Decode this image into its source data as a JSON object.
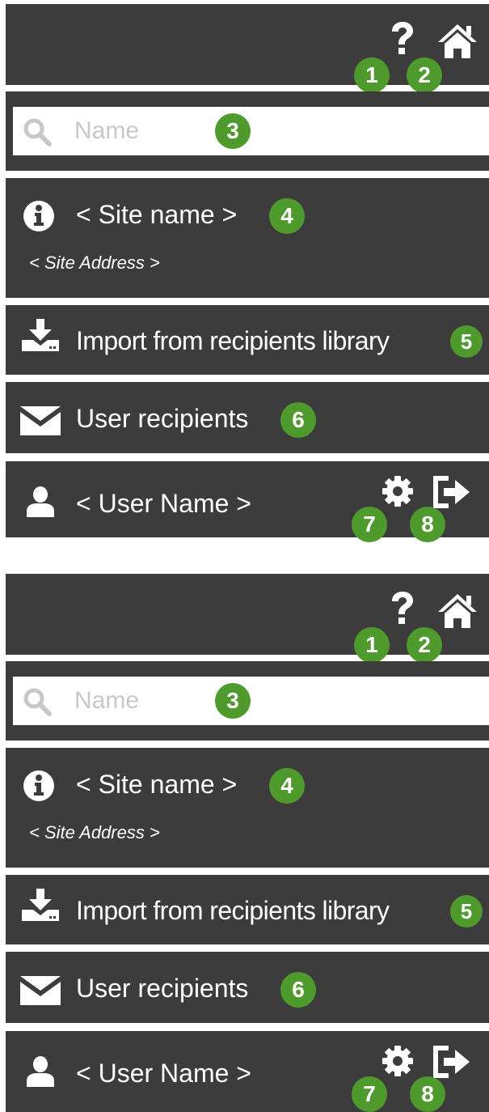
{
  "screens": [
    {
      "badges": {
        "help": "1",
        "home": "2",
        "search": "3",
        "site": "4",
        "import": "5",
        "recipients": "6",
        "settings": "7",
        "logout": "8"
      },
      "search": {
        "placeholder": "Name"
      },
      "site": {
        "name": "< Site name >",
        "address": "< Site Address >"
      },
      "import_label": "Import from recipients library",
      "recipients_label": "User recipients",
      "user_name": "< User Name >"
    },
    {
      "badges": {
        "help": "1",
        "home": "2",
        "search": "3",
        "site": "4",
        "import": "5",
        "recipients": "6",
        "settings": "7",
        "logout": "8"
      },
      "search": {
        "placeholder": "Name"
      },
      "site": {
        "name": "< Site name >",
        "address": "< Site Address >"
      },
      "import_label": "Import from recipients library",
      "recipients_label": "User recipients",
      "user_name": "< User Name >"
    }
  ],
  "colors": {
    "bar": "#3c3c3c",
    "badge": "#4f9a2c",
    "text": "#ffffff",
    "placeholder": "#c8c8c8"
  },
  "icons": [
    "question-icon",
    "home-icon",
    "search-icon",
    "info-icon",
    "download-icon",
    "envelope-icon",
    "user-icon",
    "gear-icon",
    "logout-icon"
  ]
}
